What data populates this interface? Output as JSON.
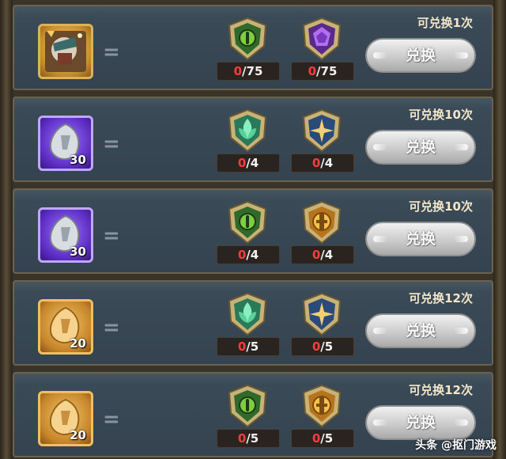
{
  "rows": [
    {
      "item": "hero-skin-card-icon",
      "item_count": "",
      "costs": [
        {
          "icon": "green-eye-badge-icon",
          "have": "0",
          "need": "/75"
        },
        {
          "icon": "purple-crown-badge-icon",
          "have": "0",
          "need": "/75"
        }
      ],
      "limit": "可兑换1次",
      "button": "兑换"
    },
    {
      "item": "silver-crystal-purple-icon",
      "item_count": "30",
      "costs": [
        {
          "icon": "green-leaf-badge-icon",
          "have": "0",
          "need": "/4"
        },
        {
          "icon": "blue-star-badge-icon",
          "have": "0",
          "need": "/4"
        }
      ],
      "limit": "可兑换10次",
      "button": "兑换"
    },
    {
      "item": "silver-crystal-purple-icon",
      "item_count": "30",
      "costs": [
        {
          "icon": "green-eye-badge-icon",
          "have": "0",
          "need": "/4"
        },
        {
          "icon": "gold-emblem-badge-icon",
          "have": "0",
          "need": "/4"
        }
      ],
      "limit": "可兑换10次",
      "button": "兑换"
    },
    {
      "item": "gold-crystal-icon",
      "item_count": "20",
      "costs": [
        {
          "icon": "green-leaf-badge-icon",
          "have": "0",
          "need": "/5"
        },
        {
          "icon": "blue-star-badge-icon",
          "have": "0",
          "need": "/5"
        }
      ],
      "limit": "可兑换12次",
      "button": "兑换"
    },
    {
      "item": "gold-crystal-icon",
      "item_count": "20",
      "costs": [
        {
          "icon": "green-eye-badge-icon",
          "have": "0",
          "need": "/5"
        },
        {
          "icon": "gold-emblem-badge-icon",
          "have": "0",
          "need": "/5"
        }
      ],
      "limit": "可兑换12次",
      "button": "兑换"
    }
  ],
  "equals_sign": "=",
  "watermark": "头条 @抠门游戏",
  "colors": {
    "row_bg": "#3b4b57",
    "row_border": "#6c6250",
    "count_have": "#ff3c3c",
    "button_gray": "#c8c8c8"
  }
}
